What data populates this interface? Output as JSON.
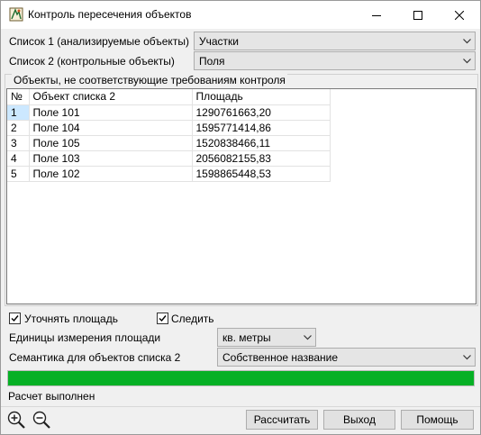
{
  "window": {
    "title": "Контроль пересечения объектов"
  },
  "list1": {
    "label": "Список 1 (анализируемые объекты)",
    "value": "Участки"
  },
  "list2": {
    "label": "Список 2 (контрольные объекты)",
    "value": "Поля"
  },
  "group": {
    "title": "Объекты, не соответствующие требованиям контроля",
    "columns": [
      "№",
      "Объект списка 2",
      "Площадь"
    ],
    "rows": [
      [
        "1",
        "Поле 101",
        "1290761663,20"
      ],
      [
        "2",
        "Поле 104",
        "1595771414,86"
      ],
      [
        "3",
        "Поле 105",
        "1520838466,11"
      ],
      [
        "4",
        "Поле 103",
        "2056082155,83"
      ],
      [
        "5",
        "Поле 102",
        "1598865448,53"
      ]
    ]
  },
  "options": {
    "refine_area": {
      "label": "Уточнять площадь",
      "checked": true
    },
    "track": {
      "label": "Следить",
      "checked": true
    }
  },
  "units": {
    "label": "Единицы измерения площади",
    "value": "кв. метры"
  },
  "semantics": {
    "label": "Семантика для объектов списка 2",
    "value": "Собственное название"
  },
  "progress": {
    "percent": 100,
    "color": "#06b025"
  },
  "status": {
    "text": "Расчет выполнен"
  },
  "buttons": {
    "calculate": "Рассчитать",
    "exit": "Выход",
    "help": "Помощь"
  },
  "icons": {
    "app": "app-icon",
    "zoom_in": "zoom-in-icon",
    "zoom_out": "zoom-out-icon"
  }
}
